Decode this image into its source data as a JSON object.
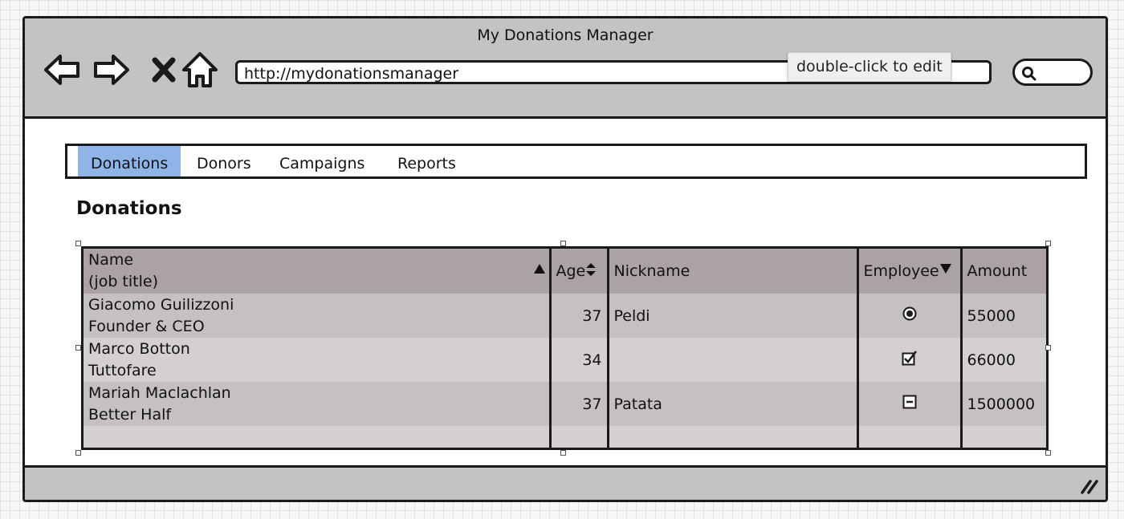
{
  "window": {
    "title": "My Donations Manager"
  },
  "toolbar": {
    "url": "http://mydonationsmanager",
    "tooltip": "double-click to edit",
    "icons": [
      "back-arrow-icon",
      "forward-arrow-icon",
      "close-x-icon",
      "home-icon",
      "search-icon"
    ]
  },
  "tabs": [
    {
      "label": "Donations",
      "active": true
    },
    {
      "label": "Donors",
      "active": false
    },
    {
      "label": "Campaigns",
      "active": false
    },
    {
      "label": "Reports",
      "active": false
    }
  ],
  "page": {
    "title": "Donations"
  },
  "table": {
    "columns": {
      "name": {
        "line1": "Name",
        "line2": "(job title)",
        "sort": "ascending"
      },
      "age": {
        "label": "Age",
        "sort": "sortable"
      },
      "nickname": {
        "label": "Nickname"
      },
      "employee": {
        "label": "Employee",
        "sort": "descending"
      },
      "amount": {
        "label": "Amount"
      }
    },
    "rows": [
      {
        "name": "Giacomo Guilizzoni",
        "title": "Founder & CEO",
        "age": "37",
        "nickname": "Peldi",
        "employee": "radio-selected",
        "amount": "55000"
      },
      {
        "name": "Marco Botton",
        "title": "Tuttofare",
        "age": "34",
        "nickname": "",
        "employee": "checkbox-checked",
        "amount": "66000"
      },
      {
        "name": "Mariah Maclachlan",
        "title": "Better Half",
        "age": "37",
        "nickname": "Patata",
        "employee": "checkbox-indeterminate",
        "amount": "1500000"
      }
    ]
  },
  "colors": {
    "active_tab": "#8fb4e8",
    "header_bg": "#aba3a3",
    "chrome": "#c4c2c2"
  }
}
